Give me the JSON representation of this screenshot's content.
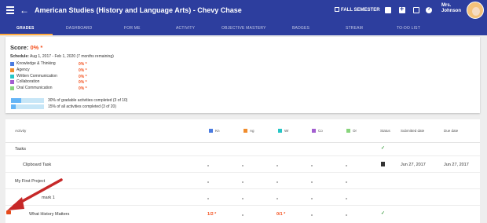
{
  "appbar": {
    "title": "American Studies (History and Language Arts) - Chevy Chase",
    "back_icon": "←",
    "semester": "FALL SEMESTER",
    "user_line1": "Mrs.",
    "user_line2": "Johnson"
  },
  "tabs": [
    "GRADES",
    "DASHBOARD",
    "FOR ME",
    "ACTIVITY",
    "OBJECTIVE MASTERY",
    "BADGES",
    "STREAM",
    "TO-DO LIST"
  ],
  "score": {
    "label": "Score:",
    "value": "0% *",
    "schedule_label": "Schedule:",
    "schedule_value": "Aug 1, 2017 - Feb 1, 2020 (7 months remaining)"
  },
  "categories": [
    {
      "name": "Knowledge & Thinking",
      "value": "0% *",
      "color": "#4a7be0"
    },
    {
      "name": "Agency",
      "value": "0% *",
      "color": "#f08c2c"
    },
    {
      "name": "Written Communication",
      "value": "0% *",
      "color": "#26c6c6"
    },
    {
      "name": "Collaboration",
      "value": "0% *",
      "color": "#a35ed0"
    },
    {
      "name": "Oral Communication",
      "value": "0% *",
      "color": "#88d47c"
    }
  ],
  "progress": [
    {
      "text": "30% of gradable activities completed (3 of 10)",
      "fraction": 0.3
    },
    {
      "text": "15% of all activities completed (3 of 20)",
      "fraction": 0.15
    }
  ],
  "table": {
    "headers": {
      "activity": "Activity",
      "kn": "Kn",
      "ag": "Ag",
      "wr": "Wr",
      "co": "Co",
      "or": "Or",
      "status": "Status",
      "submitted": "Submitted date",
      "due": "Due date"
    },
    "header_colors": {
      "kn": "#4a7be0",
      "ag": "#f08c2c",
      "wr": "#26c6c6",
      "co": "#a35ed0",
      "or": "#88d47c"
    },
    "rows": [
      {
        "activity": "Tasks",
        "status": "✓",
        "submitted": "",
        "due": ""
      },
      {
        "activity": "Clipboard Task",
        "status": "",
        "submitted": "Jun 27, 2017",
        "due": "Jun 27, 2017"
      },
      {
        "activity": "My First Project",
        "status": "",
        "submitted": "",
        "due": ""
      },
      {
        "activity": "mark 1",
        "status": "",
        "submitted": "",
        "due": ""
      },
      {
        "activity": "What History Matters",
        "kn": "1/2 *",
        "wr": "0/1 *",
        "status": "✓",
        "submitted": "",
        "due": ""
      }
    ]
  }
}
